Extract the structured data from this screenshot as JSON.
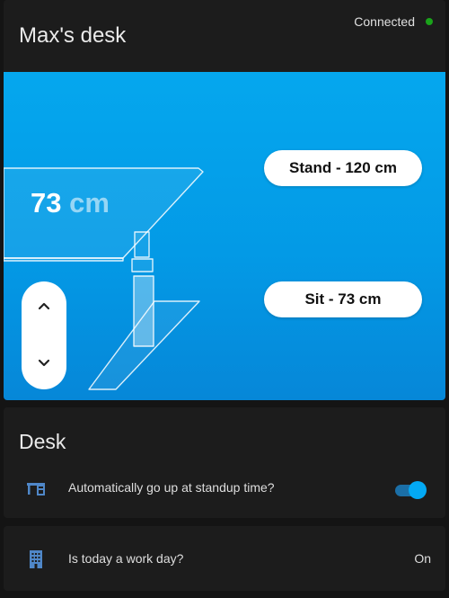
{
  "header": {
    "title": "Max's desk",
    "status": "Connected"
  },
  "desk": {
    "current_height_value": "73",
    "current_height_unit": "cm",
    "presets": {
      "stand": "Stand - 120 cm",
      "sit": "Sit - 73 cm"
    },
    "controls": {
      "up_icon": "chevron-up-icon",
      "down_icon": "chevron-down-icon"
    }
  },
  "settings": {
    "title": "Desk",
    "auto_standup": {
      "icon": "desk-icon",
      "label": "Automatically go up at standup time?",
      "enabled": true
    }
  },
  "workday": {
    "icon": "office-building-icon",
    "label": "Is today a work day?",
    "value": "On"
  },
  "colors": {
    "accent": "#03a9f4",
    "status_connected": "#1aa31a",
    "scene_top": "#05a7ee",
    "scene_bottom": "#0687d8",
    "card_bg": "#1c1c1c",
    "page_bg": "#141414"
  }
}
